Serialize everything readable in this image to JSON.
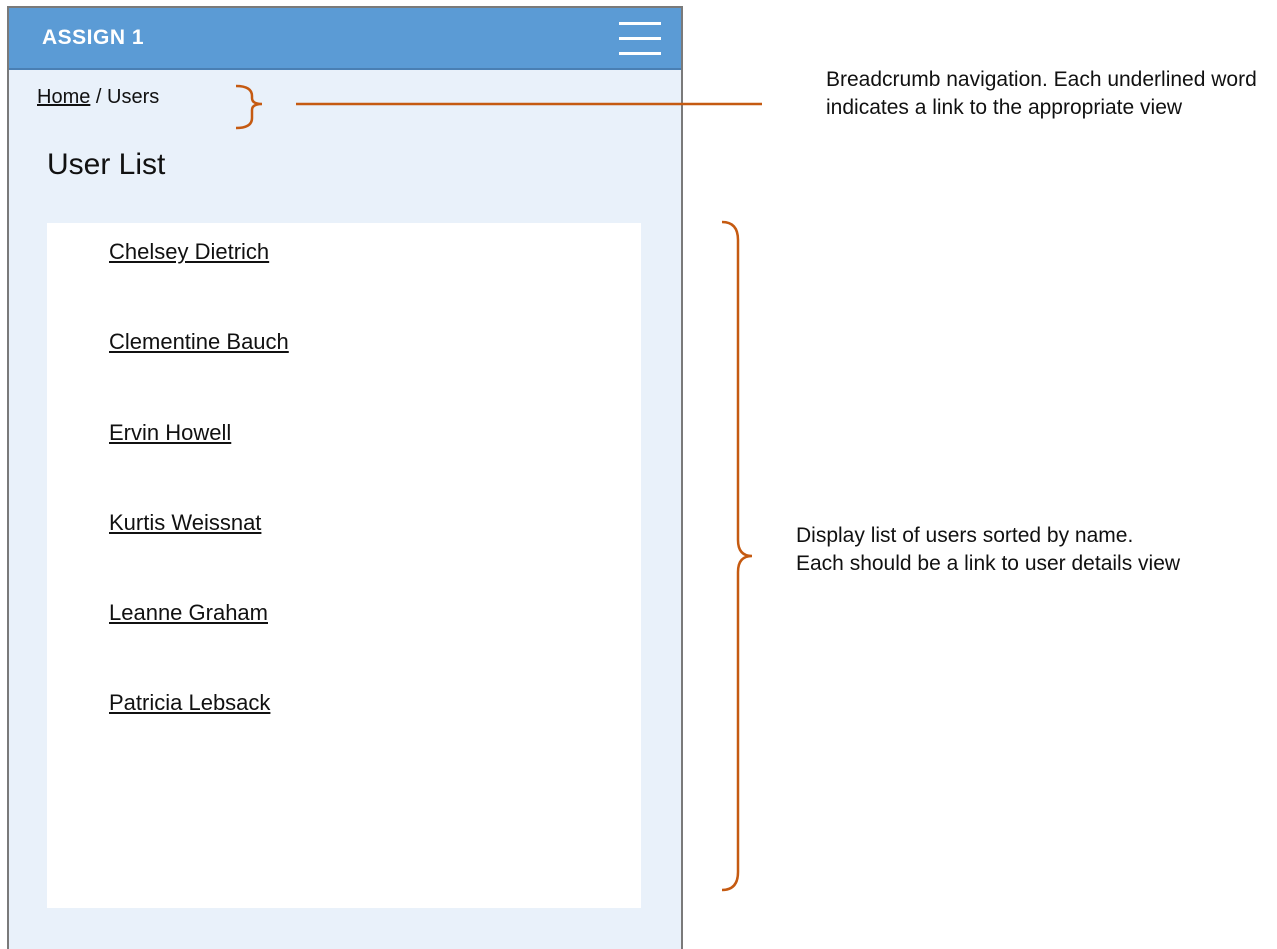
{
  "app": {
    "title": "ASSIGN 1",
    "menu_icon": "hamburger-menu-icon"
  },
  "breadcrumb": {
    "home": "Home",
    "separator": " / ",
    "current": "Users"
  },
  "page_title": "User List",
  "users": [
    "Chelsey Dietrich",
    "Clementine Bauch",
    "Ervin Howell",
    "Kurtis Weissnat",
    "Leanne Graham",
    "Patricia Lebsack"
  ],
  "annotations": {
    "breadcrumb_note": "Breadcrumb navigation. Each underlined word indicates a link to the appropriate view",
    "list_note_line1": "Display list of users sorted by name.",
    "list_note_line2": "Each should be a link to user details view"
  },
  "colors": {
    "app_bar": "#5b9bd5",
    "content_background": "#e9f1fa",
    "annotation": "#c55a11"
  }
}
